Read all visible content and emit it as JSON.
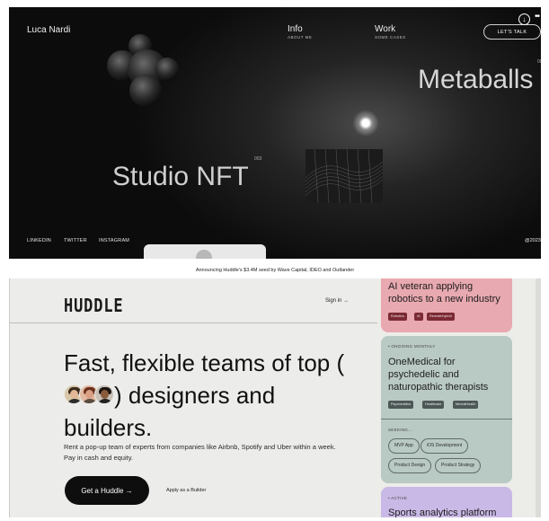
{
  "portfolio": {
    "name": "Luca Nardi",
    "nav": [
      {
        "label": "Info",
        "sub": "ABOUT ME"
      },
      {
        "label": "Work",
        "sub": "SOME CASES"
      }
    ],
    "cta": "LET'S TALK",
    "more": "••",
    "download_icon": "↓",
    "project_index_right": "002",
    "project_right": "Metaballs",
    "project_index_left": "003",
    "project_left": "Studio NFT",
    "social": [
      "LINKEDIN",
      "TWITTER",
      "INSTAGRAM"
    ],
    "year": "@2023"
  },
  "announcement": "Announcing Huddle's $3.4M seed by Wave Capital, IDEO and Outlander",
  "huddle": {
    "logo": "HUDDLE",
    "signin": "Sign in →",
    "headline_part1": "Fast, flexible teams of top (",
    "headline_part2": ") designers and builders.",
    "subtext": "Rent a pop-up team of experts from companies like Airbnb, Spotify and Uber within a week. Pay in cash and equity.",
    "cta": "Get a Huddle →",
    "secondary": "Apply as a Builder"
  },
  "cards": {
    "red": {
      "title": "AI veteran applying robotics to a new industry",
      "tags": [
        "Robotics",
        "AI",
        "Remote/hybrid"
      ]
    },
    "green": {
      "label": "• ONGOING MONTHLY",
      "title": "OneMedical for psychedelic and naturopathic therapists",
      "tags": [
        "Psychedelics",
        "Healthcare",
        "MentalHealth"
      ],
      "seeking_label": "SEEKING...",
      "roles": [
        "MVP App",
        "iOS Development",
        "Product Design",
        "Product Strategy"
      ]
    },
    "purple": {
      "label": "• ACTIVE",
      "title": "Sports analytics platform"
    }
  },
  "colors": {
    "hero_bg": "#0c0c0c",
    "page_bg": "#ececea",
    "cta_bg": "#0e0e0e",
    "card_red": "#e8a9b0",
    "card_green": "#b9c9c4",
    "card_purple": "#c9b9e6"
  }
}
